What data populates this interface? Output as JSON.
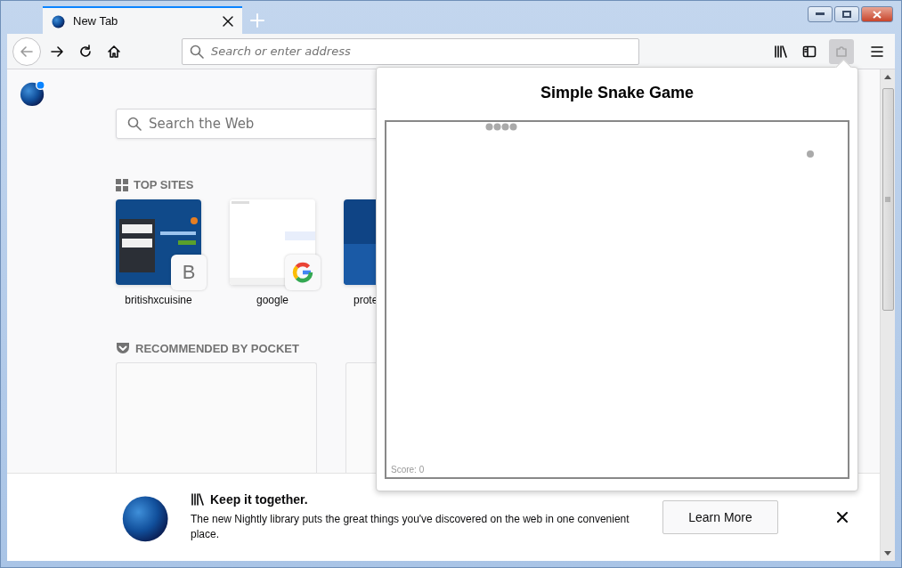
{
  "tabs": [
    {
      "title": "New Tab",
      "selected": true
    }
  ],
  "address_bar": {
    "placeholder": "Search or enter address"
  },
  "extension_button": {
    "open": true
  },
  "new_tab_page": {
    "search": {
      "placeholder": "Search the Web"
    },
    "top_sites": {
      "title": "TOP SITES",
      "sites": [
        {
          "label": "britishxcuisine",
          "kind": "letter",
          "badge": "B"
        },
        {
          "label": "google",
          "kind": "logo"
        },
        {
          "label": "prote",
          "kind": "plain"
        }
      ]
    },
    "pocket": {
      "title": "RECOMMENDED BY POCKET"
    }
  },
  "notification": {
    "title": "Keep it together.",
    "text": "The new Nightly library puts the great things you've discovered on the web in one convenient place.",
    "button": "Learn More"
  },
  "popup": {
    "title": "Simple Snake Game",
    "score": "Score: 0"
  }
}
